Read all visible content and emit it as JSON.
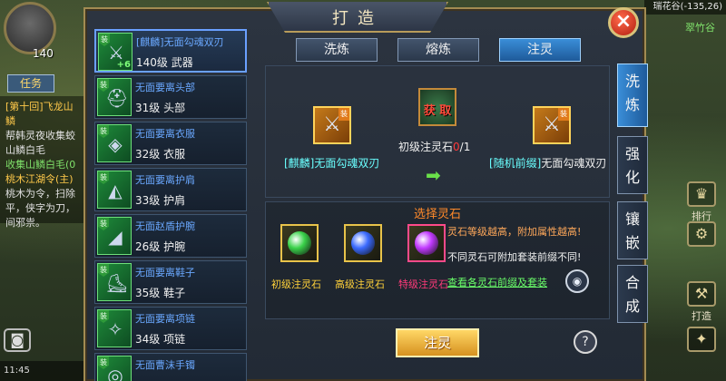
{
  "hud": {
    "player_level": "140",
    "task_tab": "任务",
    "quest_lines": [
      {
        "text": "[第十回]飞龙山鳞",
        "cls": "q-title"
      },
      {
        "text": "帮韩灵夜收集蛟",
        "cls": "q-txt"
      },
      {
        "text": "山鳞白毛",
        "cls": "q-txt"
      },
      {
        "text": "收集山鳞白毛(0",
        "cls": "q-green"
      },
      {
        "text": "桃木江湖令(主)",
        "cls": "q-title"
      },
      {
        "text": "桃木为令，扫除",
        "cls": "q-txt"
      },
      {
        "text": "平，侠字为刀，",
        "cls": "q-txt"
      },
      {
        "text": "间邪祟。",
        "cls": "q-txt"
      }
    ],
    "bottom_left": "11:45",
    "coords": "瑞花谷(-135,26)",
    "minimap_label": "翠竹谷",
    "side_actions": [
      {
        "label": "排行",
        "glyph": "♛"
      },
      {
        "label": "",
        "glyph": "⚙"
      },
      {
        "label": "打造",
        "glyph": "⚒"
      },
      {
        "label": "",
        "glyph": "✦"
      }
    ]
  },
  "panel": {
    "title": "打造",
    "close_glyph": "×",
    "top_tabs": [
      "洗炼",
      "熔炼",
      "注灵"
    ],
    "active_top_tab": 2,
    "vertical_tabs": [
      "洗炼",
      "强化",
      "镶嵌",
      "合成"
    ],
    "active_vertical_tab": 0,
    "item_list": [
      {
        "name": "[麒麟]无面勾魂双刃",
        "level": "140级 武器",
        "glyph": "⚔",
        "plus": "+6",
        "selected": true,
        "green": false
      },
      {
        "name": "无面要离头部",
        "level": "31级 头部",
        "glyph": "⛑",
        "plus": "",
        "selected": false,
        "green": false
      },
      {
        "name": "无面要离衣服",
        "level": "32级 衣服",
        "glyph": "◈",
        "plus": "",
        "selected": false,
        "green": false
      },
      {
        "name": "无面要离护肩",
        "level": "33级 护肩",
        "glyph": "◭",
        "plus": "",
        "selected": false,
        "green": false
      },
      {
        "name": "无面赵盾护腕",
        "level": "26级 护腕",
        "glyph": "◢",
        "plus": "",
        "selected": false,
        "green": false
      },
      {
        "name": "无面要离鞋子",
        "level": "35级 鞋子",
        "glyph": "⛸",
        "plus": "",
        "selected": false,
        "green": false
      },
      {
        "name": "无面要离项链",
        "level": "34级 项链",
        "glyph": "✧",
        "plus": "",
        "selected": false,
        "green": false
      },
      {
        "name": "无面曹沫手镯",
        "level": "",
        "glyph": "◎",
        "plus": "",
        "selected": false,
        "green": false
      }
    ],
    "badge_char": "装",
    "work": {
      "source_item": "[麒麟]无面勾魂双刃",
      "acquire_label": "获 取",
      "stone_req_prefix": "初级注灵石",
      "stone_req_have": "0",
      "stone_req_total": "/1",
      "result_prefix": "[随机前缀]",
      "result_name": "无面勾魂双刃"
    },
    "stones": {
      "title": "选择灵石",
      "items": [
        {
          "label": "初级注灵石",
          "color": "#ffd23a",
          "orb": "#3ad24a"
        },
        {
          "label": "高级注灵石",
          "color": "#ffd23a",
          "orb": "#3a6aff"
        },
        {
          "label": "特级注灵石",
          "color": "#ff3a7a",
          "orb": "#c23aff"
        }
      ],
      "info_1": "灵石等级越高，附加属性越高!",
      "info_2": "不同灵石可附加套装前缀不同!",
      "link": "查看各灵石前缀及套装",
      "eye_glyph": "◉"
    },
    "action_button": "注灵",
    "help_glyph": "?"
  }
}
